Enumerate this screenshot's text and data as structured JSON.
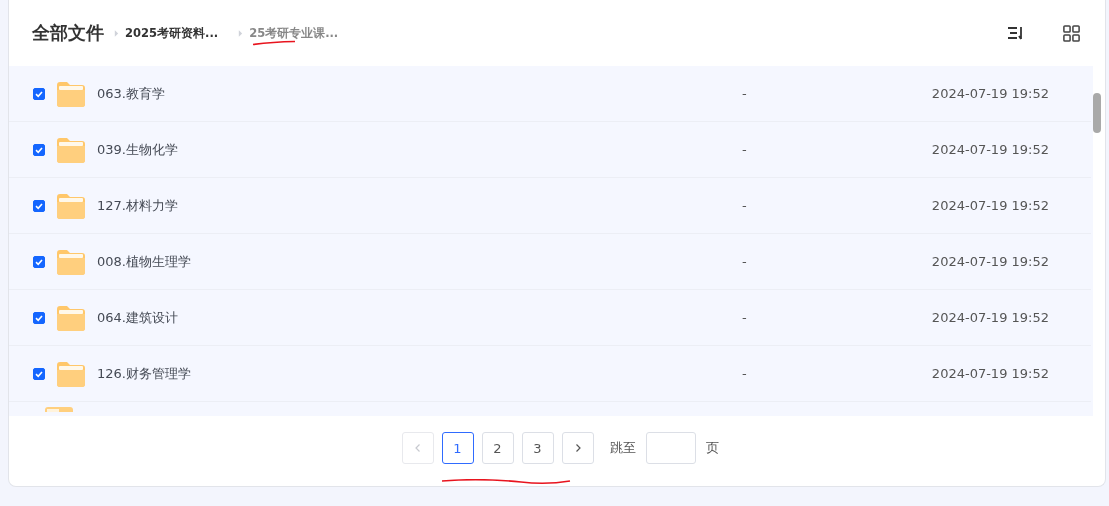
{
  "header": {
    "title": "全部文件",
    "breadcrumbs": [
      {
        "label": "2025考研资料...",
        "current": false
      },
      {
        "label": "25考研专业课...",
        "current": true
      }
    ]
  },
  "files": [
    {
      "name": "063.教育学",
      "size": "-",
      "modified": "2024-07-19 19:52",
      "checked": true
    },
    {
      "name": "039.生物化学",
      "size": "-",
      "modified": "2024-07-19 19:52",
      "checked": true
    },
    {
      "name": "127.材料力学",
      "size": "-",
      "modified": "2024-07-19 19:52",
      "checked": true
    },
    {
      "name": "008.植物生理学",
      "size": "-",
      "modified": "2024-07-19 19:52",
      "checked": true
    },
    {
      "name": "064.建筑设计",
      "size": "-",
      "modified": "2024-07-19 19:52",
      "checked": true
    },
    {
      "name": "126.财务管理学",
      "size": "-",
      "modified": "2024-07-19 19:52",
      "checked": true
    }
  ],
  "pagination": {
    "prev_disabled": true,
    "pages": [
      {
        "label": "1",
        "selected": true
      },
      {
        "label": "2",
        "selected": false
      },
      {
        "label": "3",
        "selected": false
      }
    ],
    "next_disabled": false,
    "jump_label": "跳至",
    "jump_suffix": "页"
  }
}
